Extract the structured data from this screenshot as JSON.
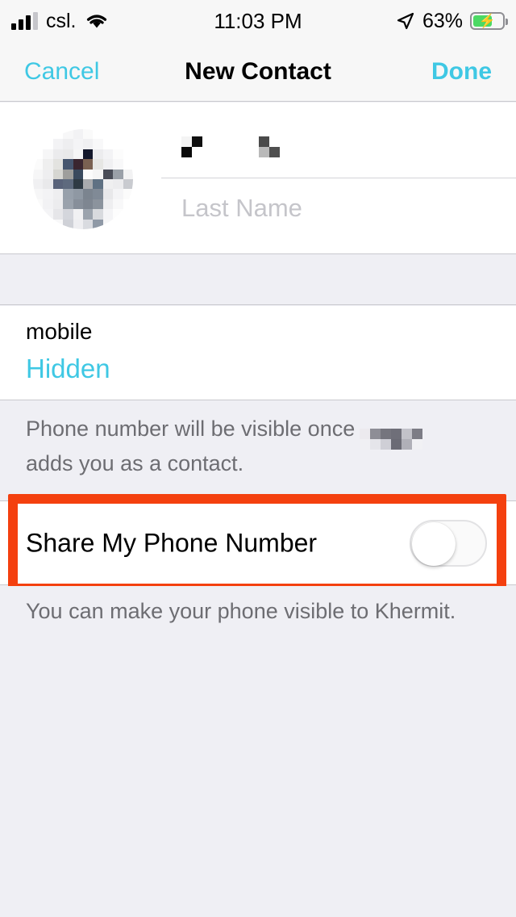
{
  "status_bar": {
    "carrier": "csl.",
    "time": "11:03 PM",
    "battery_percent": "63%",
    "signal_bars_filled": 3,
    "signal_bars_total": 4,
    "wifi_icon": "wifi-icon",
    "location_icon": "location-arrow-icon",
    "battery_icon": "battery-charging-icon",
    "battery_level": 58,
    "battery_color": "#4CD964"
  },
  "nav": {
    "cancel_label": "Cancel",
    "title": "New Contact",
    "done_label": "Done",
    "accent_color": "#3FC8E4"
  },
  "name_section": {
    "photo": "contact-photo-redacted",
    "first_name_value": "",
    "first_name_redacted": true,
    "last_name_placeholder": "Last Name",
    "last_name_value": ""
  },
  "phone_section": {
    "label": "mobile",
    "value": "Hidden",
    "value_color": "#3FC8E4"
  },
  "note_1": {
    "text_before": "Phone number will be visible once",
    "redacted_name": true,
    "text_after": "adds you as a contact."
  },
  "share_row": {
    "label": "Share My Phone Number",
    "toggle_state": "off"
  },
  "note_2": {
    "text": "You can make your phone visible to Khermit."
  },
  "annotation": {
    "highlight_color": "#F4400F",
    "target": "share-my-phone-number-row"
  }
}
